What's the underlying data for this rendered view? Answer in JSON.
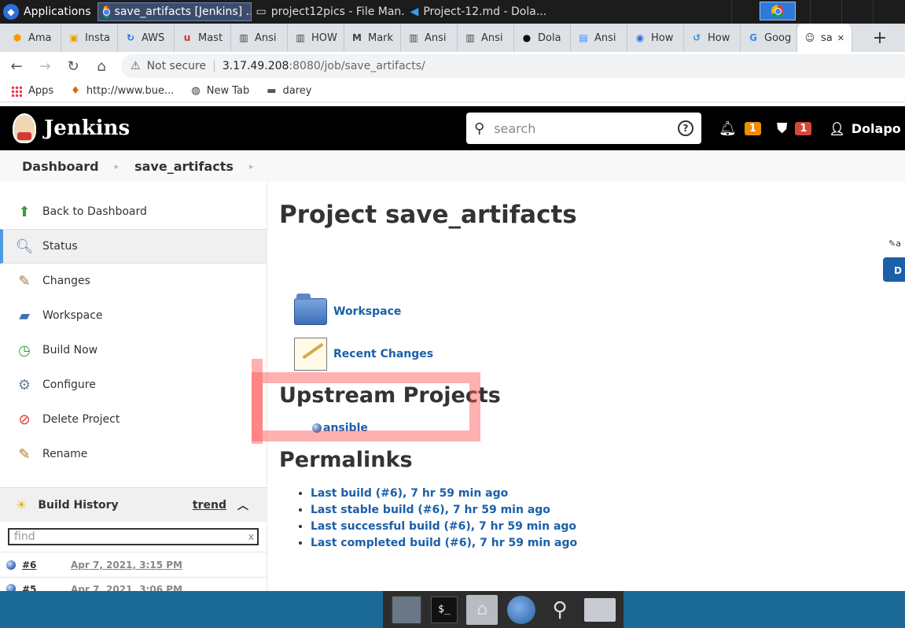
{
  "os_taskbar": {
    "apps_label": "Applications",
    "windows": [
      {
        "label": "save_artifacts [Jenkins] ...",
        "active": true
      },
      {
        "label": "project12pics - File Man...",
        "active": false
      },
      {
        "label": "Project-12.md - Dola...",
        "active": false
      }
    ]
  },
  "browser": {
    "tabs": [
      "Ama",
      "Insta",
      "AWS",
      "Mast",
      "Ansi",
      "HOW",
      "Mark",
      "Ansi",
      "Ansi",
      "Dola",
      "Ansi",
      "How",
      "How",
      "Goog",
      "sa"
    ],
    "new_tab": "+",
    "close_tab": "✕",
    "address": {
      "security": "Not secure",
      "host": "3.17.49.208",
      "path": ":8080/job/save_artifacts/"
    },
    "bookmarks": [
      "Apps",
      "http://www.bue...",
      "New Tab",
      "darey"
    ]
  },
  "jenkins": {
    "brand": "Jenkins",
    "search_placeholder": "search",
    "notifications_count": "1",
    "security_count": "1",
    "user": "Dolapo",
    "breadcrumbs": [
      "Dashboard",
      "save_artifacts"
    ],
    "sidebar": [
      {
        "label": "Back to Dashboard",
        "icon": "arrow-up-icon"
      },
      {
        "label": "Status",
        "icon": "magnifier-icon"
      },
      {
        "label": "Changes",
        "icon": "notepad-icon"
      },
      {
        "label": "Workspace",
        "icon": "folder-icon"
      },
      {
        "label": "Build Now",
        "icon": "clock-icon"
      },
      {
        "label": "Configure",
        "icon": "gear-icon"
      },
      {
        "label": "Delete Project",
        "icon": "no-icon"
      },
      {
        "label": "Rename",
        "icon": "notepad-icon"
      }
    ],
    "build_history": {
      "title": "Build History",
      "trend": "trend",
      "find_placeholder": "find",
      "builds": [
        {
          "number": "#6",
          "date": "Apr 7, 2021, 3:15 PM"
        },
        {
          "number": "#5",
          "date": "Apr 7, 2021, 3:06 PM"
        }
      ]
    },
    "main": {
      "title": "Project save_artifacts",
      "description_link": "a",
      "disable_button": "D",
      "links": [
        "Workspace",
        "Recent Changes"
      ],
      "upstream_title": "Upstream Projects",
      "upstream_item": "ansible",
      "permalinks_title": "Permalinks",
      "permalinks": [
        "Last build (#6), 7 hr 59 min ago",
        "Last stable build (#6), 7 hr 59 min ago",
        "Last successful build (#6), 7 hr 59 min ago",
        "Last completed build (#6), 7 hr 59 min ago"
      ]
    }
  }
}
